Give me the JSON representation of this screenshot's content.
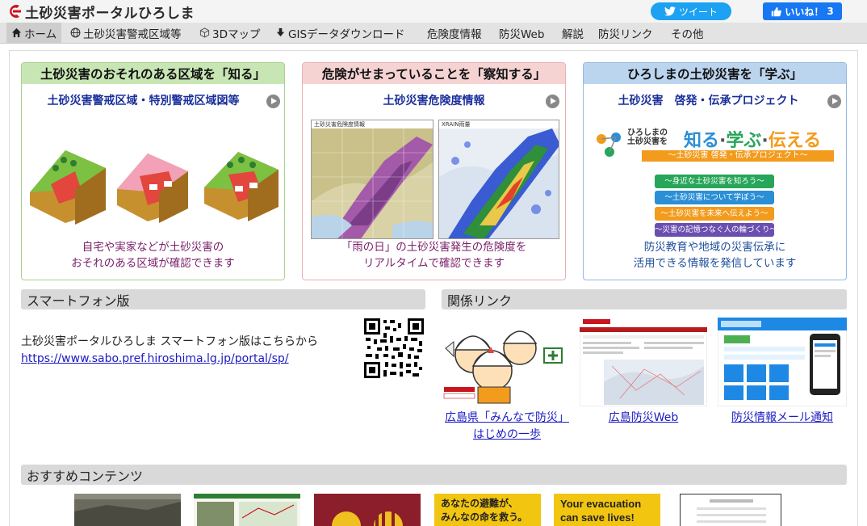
{
  "header": {
    "site_title": "土砂災害ポータルひろしま",
    "tweet_label": "ツイート",
    "like_label": "いいね！",
    "like_count": "3"
  },
  "nav": {
    "items": [
      {
        "label": "ホーム",
        "icon": "home-icon"
      },
      {
        "label": "土砂災害警戒区域等",
        "icon": "globe-icon"
      },
      {
        "label": "3Dマップ",
        "icon": "cube-icon"
      },
      {
        "label": "GISデータダウンロード",
        "icon": "download-icon"
      },
      {
        "label": "危険度情報"
      },
      {
        "label": "防災Web"
      },
      {
        "label": "解説"
      },
      {
        "label": "防災リンク"
      },
      {
        "label": "その他"
      }
    ]
  },
  "cards": [
    {
      "heading": "土砂災害のおそれのある区域を「知る」",
      "subtitle": "土砂災害警戒区域・特別警戒区域図等",
      "desc_line1": "自宅や実家などが土砂災害の",
      "desc_line2": "おそれのある区域が確認できます",
      "accent": "#c8e6b4",
      "border": "#a9d18e"
    },
    {
      "heading": "危険がせまっていることを「察知する」",
      "subtitle": "土砂災害危険度情報",
      "desc_line1": "「雨の日」の土砂災害発生の危険度を",
      "desc_line2": "リアルタイムで確認できます",
      "panel1_title": "土砂災害危険度情報",
      "panel2_title": "XRAIN雨量",
      "accent": "#f6d3d3",
      "border": "#eab1b1"
    },
    {
      "heading": "ひろしまの土砂災害を「学ぶ」",
      "subtitle": "土砂災害　啓発・伝承プロジェクト",
      "desc_line1": "防災教育や地域の災害伝承に",
      "desc_line2": "活用できる情報を発信しています",
      "logo_small": "ひろしまの\n土砂災害を",
      "logo_big_1": "知る",
      "logo_big_2": "学ぶ",
      "logo_big_3": "伝える",
      "logo_sub": "〜土砂災害 啓発・伝承プロジェクト〜",
      "pills": [
        "〜身近な土砂災害を知ろう〜",
        "〜土砂災害について学ぼう〜",
        "〜土砂災害を未来へ伝えよう〜",
        "〜災害の記憶つなぐ人の輪づくり〜"
      ],
      "pill_colors": [
        "#27a55a",
        "#2b8fd6",
        "#f29b1d",
        "#6a4fb0"
      ],
      "accent": "#bcd5ef",
      "border": "#93b8e0"
    }
  ],
  "smartphone": {
    "heading": "スマートフォン版",
    "text": "土砂災害ポータルひろしま スマートフォン版はこちらから",
    "url": "https://www.sabo.pref.hiroshima.lg.jp/portal/sp/"
  },
  "related": {
    "heading": "関係リンク",
    "links": [
      {
        "line1": "広島県「みんなで防災」",
        "line2": "はじめの一歩"
      },
      {
        "line1": "広島防災Web"
      },
      {
        "line1": "防災情報メール通知"
      }
    ]
  },
  "recommended": {
    "heading": "おすすめコンテンツ",
    "tile4": "あなたの避難が、\nみんなの命を救う。",
    "tile5": "Your evacuation\ncan save lives!"
  }
}
